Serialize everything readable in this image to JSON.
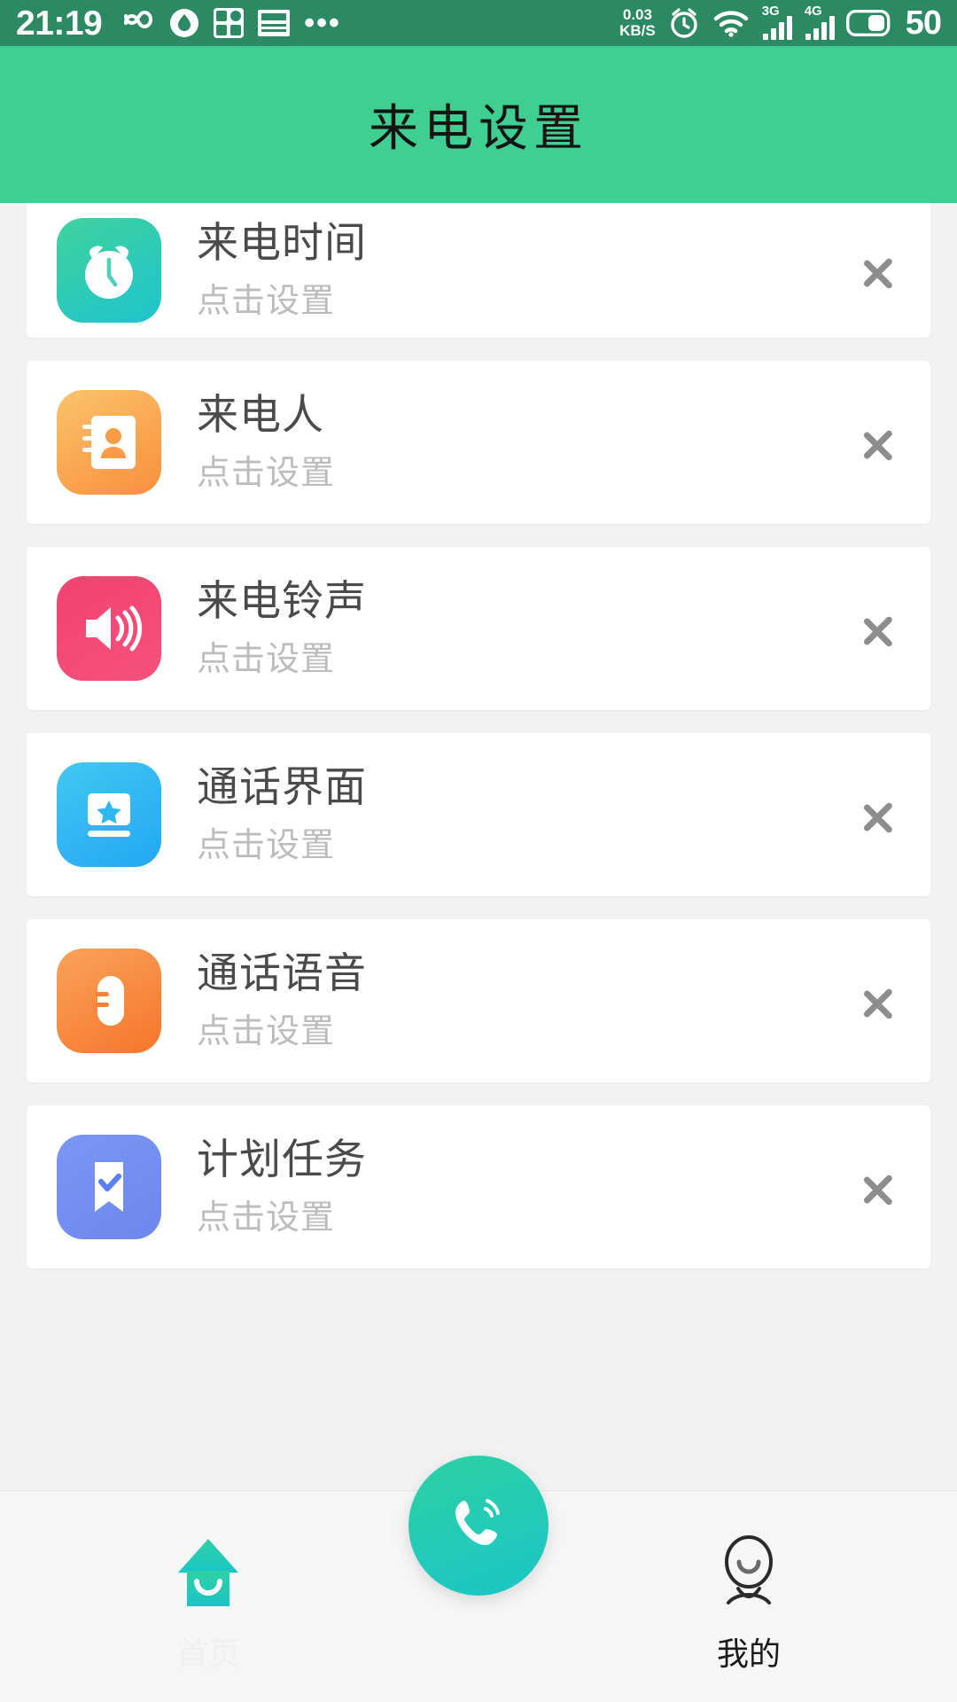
{
  "status_bar": {
    "time": "21:19",
    "icons_left": [
      "infinity-icon",
      "droplet-circle-icon",
      "app-grid-icon",
      "news-icon"
    ],
    "overflow": "•••",
    "net_speed_value": "0.03",
    "net_speed_unit": "KB/S",
    "icons_right": [
      "alarm-icon",
      "wifi-icon"
    ],
    "sim1_label": "3G",
    "sim2_label": "4G",
    "battery_percent": "50",
    "bg_color": "#2b8a63"
  },
  "header": {
    "title": "来电设置",
    "bg_color": "#3fcf93",
    "text_color": "#141414"
  },
  "list": {
    "items": [
      {
        "title": "来电时间",
        "subtitle": "点击设置",
        "icon": "alarm-clock-icon",
        "color_start": "#3fd39b",
        "color_end": "#1fc3cf"
      },
      {
        "title": "来电人",
        "subtitle": "点击设置",
        "icon": "contact-book-icon",
        "color_start": "#fbc36a",
        "color_end": "#fa8f3c"
      },
      {
        "title": "来电铃声",
        "subtitle": "点击设置",
        "icon": "speaker-volume-icon",
        "color_start": "#f2426f",
        "color_end": "#f4527c"
      },
      {
        "title": "通话界面",
        "subtitle": "点击设置",
        "icon": "screen-star-icon",
        "color_start": "#41c8f0",
        "color_end": "#22a7f5"
      },
      {
        "title": "通话语音",
        "subtitle": "点击设置",
        "icon": "microphone-icon",
        "color_start": "#fba25a",
        "color_end": "#f5762a"
      },
      {
        "title": "计划任务",
        "subtitle": "点击设置",
        "icon": "bookmark-check-icon",
        "color_start": "#7b96f5",
        "color_end": "#6f86ee"
      }
    ],
    "chevron": "chevron-right-icon",
    "bg_color": "#f2f2f2",
    "card_color": "#ffffff"
  },
  "tabbar": {
    "home": {
      "label": "首页",
      "icon": "home-icon",
      "color": "#2fd0a4"
    },
    "call": {
      "label": "",
      "icon": "phone-call-icon",
      "color": "#19c6c6"
    },
    "mine": {
      "label": "我的",
      "icon": "profile-icon",
      "color": "#1a1a1a"
    }
  }
}
